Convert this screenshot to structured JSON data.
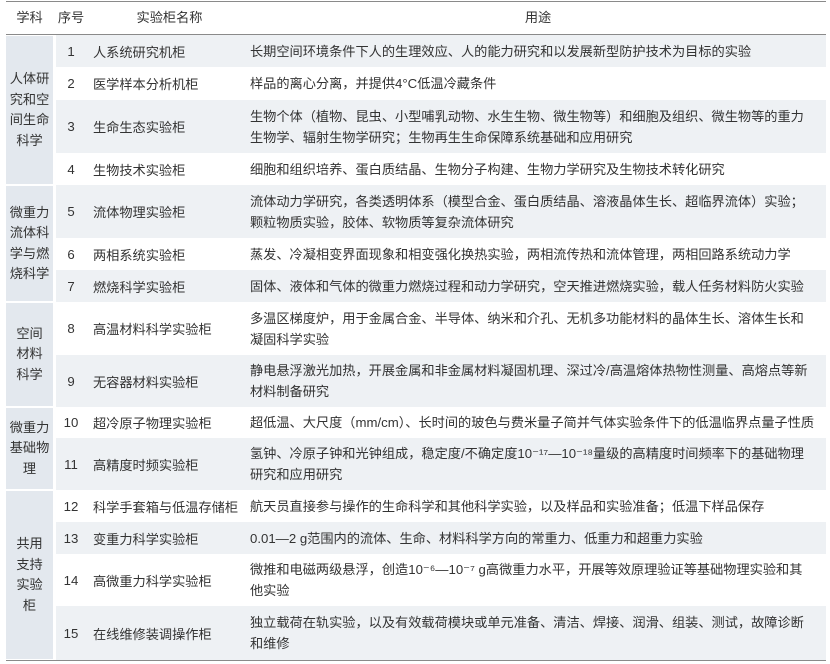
{
  "colors": {
    "text": "#333333",
    "row-shade": "#eef1f4",
    "subject-bg": "#e3e8ee",
    "rule": "#8a8a8a"
  },
  "header": {
    "subject": "学科",
    "no": "序号",
    "name": "实验柜名称",
    "use": "用途"
  },
  "groups": [
    {
      "lines": [
        "人体研",
        "究和空",
        "间生命",
        "科学"
      ]
    },
    {
      "lines": [
        "微重力",
        "流体科",
        "学与燃",
        "烧科学"
      ]
    },
    {
      "lines": [
        "空间",
        "材料",
        "科学"
      ]
    },
    {
      "lines": [
        "微重力",
        "基础物",
        "理"
      ]
    },
    {
      "lines": [
        "共用",
        "支持",
        "实验",
        "柜"
      ]
    }
  ],
  "rows": [
    {
      "no": "1",
      "name": "人系统研究机柜",
      "use": [
        "长期空间环境条件下人的生理效应、人的能力研究和以发展新型防护技术为目标的实验"
      ]
    },
    {
      "no": "2",
      "name": "医学样本分析机柜",
      "use": [
        "样品的离心分离，并提供4°C低温冷藏条件"
      ]
    },
    {
      "no": "3",
      "name": "生命生态实验柜",
      "use": [
        "生物个体（植物、昆虫、小型哺乳动物、水生生物、微生物等）和细胞及组织、微生物等的重力",
        "生物学、辐射生物学研究；生物再生生命保障系统基础和应用研究"
      ]
    },
    {
      "no": "4",
      "name": "生物技术实验柜",
      "use": [
        "细胞和组织培养、蛋白质结晶、生物分子构建、生物力学研究及生物技术转化研究"
      ]
    },
    {
      "no": "5",
      "name": "流体物理实验柜",
      "use": [
        "流体动力学研究，各类透明体系（模型合金、蛋白质结晶、溶液晶体生长、超临界流体）实验；",
        "颗粒物质实验，胶体、软物质等复杂流体研究"
      ]
    },
    {
      "no": "6",
      "name": "两相系统实验柜",
      "use": [
        "蒸发、冷凝相变界面现象和相变强化换热实验，两相流传热和流体管理，两相回路系统动力学"
      ]
    },
    {
      "no": "7",
      "name": "燃烧科学实验柜",
      "use": [
        "固体、液体和气体的微重力燃烧过程和动力学研究，空天推进燃烧实验，载人任务材料防火实验"
      ]
    },
    {
      "no": "8",
      "name": "高温材料科学实验柜",
      "use": [
        "多温区梯度炉，用于金属合金、半导体、纳米和介孔、无机多功能材料的晶体生长、溶体生长和",
        "凝固科学实验"
      ]
    },
    {
      "no": "9",
      "name": "无容器材料实验柜",
      "use": [
        "静电悬浮激光加热，开展金属和非金属材料凝固机理、深过冷/高温熔体热物性测量、高熔点等新",
        "材料制备研究"
      ]
    },
    {
      "no": "10",
      "name": "超冷原子物理实验柜",
      "use": [
        "超低温、大尺度（mm/cm）、长时间的玻色与费米量子简并气体实验条件下的低温临界点量子性质"
      ]
    },
    {
      "no": "11",
      "name": "高精度时频实验柜",
      "use": [
        "氢钟、冷原子钟和光钟组成，稳定度/不确定度10⁻¹⁷—10⁻¹⁸量级的高精度时间频率下的基础物理",
        "研究和应用研究"
      ]
    },
    {
      "no": "12",
      "name": "科学手套箱与低温存储柜",
      "use": [
        "航天员直接参与操作的生命科学和其他科学实验，以及样品和实验准备；低温下样品保存"
      ]
    },
    {
      "no": "13",
      "name": "变重力科学实验柜",
      "use": [
        "0.01—2 g范围内的流体、生命、材料科学方向的常重力、低重力和超重力实验"
      ]
    },
    {
      "no": "14",
      "name": "高微重力科学实验柜",
      "use": [
        "微推和电磁两级悬浮，创造10⁻⁶—10⁻⁷ g高微重力水平，开展等效原理验证等基础物理实验和其",
        "他实验"
      ]
    },
    {
      "no": "15",
      "name": "在线维修装调操作柜",
      "use": [
        "独立载荷在轨实验，以及有效载荷模块或单元准备、清洁、焊接、润滑、组装、测试，故障诊断",
        "和维修"
      ]
    }
  ]
}
